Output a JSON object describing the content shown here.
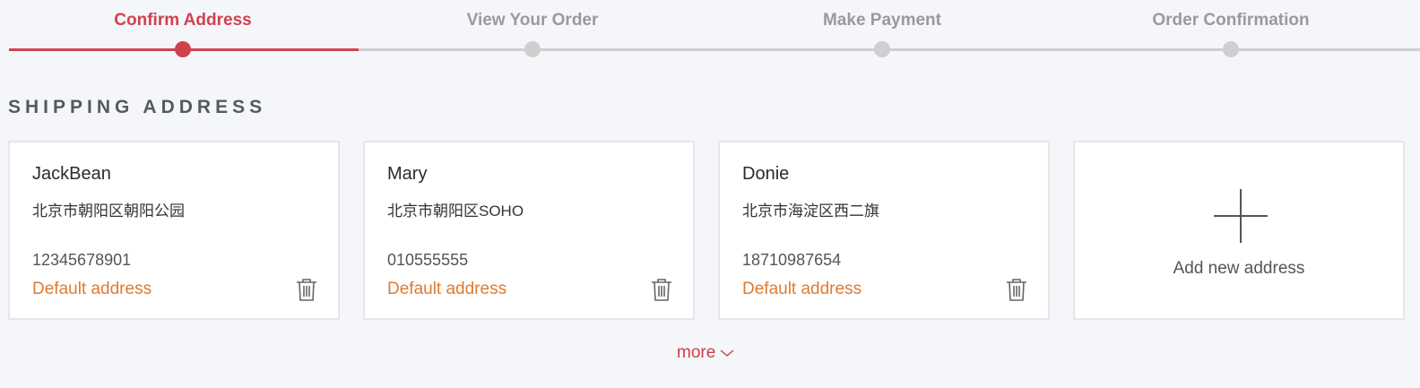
{
  "steps": [
    {
      "label": "Confirm Address",
      "active": true
    },
    {
      "label": "View Your Order",
      "active": false
    },
    {
      "label": "Make Payment",
      "active": false
    },
    {
      "label": "Order Confirmation",
      "active": false
    }
  ],
  "section": {
    "title": "SHIPPING ADDRESS"
  },
  "addresses": [
    {
      "name": "JackBean",
      "address": "北京市朝阳区朝阳公园",
      "phone": "12345678901",
      "default_label": "Default address"
    },
    {
      "name": "Mary",
      "address": "北京市朝阳区SOHO",
      "phone": "010555555",
      "default_label": "Default address"
    },
    {
      "name": "Donie",
      "address": "北京市海淀区西二旗",
      "phone": "18710987654",
      "default_label": "Default address"
    }
  ],
  "add_card": {
    "label": "Add new address",
    "icon": "plus-icon"
  },
  "more": {
    "label": "more",
    "icon": "chevron-down-icon"
  },
  "colors": {
    "accent": "#d0414f",
    "inactive": "#cfcfcf",
    "default_link": "#e07a2f",
    "background": "#f5f6fa"
  }
}
